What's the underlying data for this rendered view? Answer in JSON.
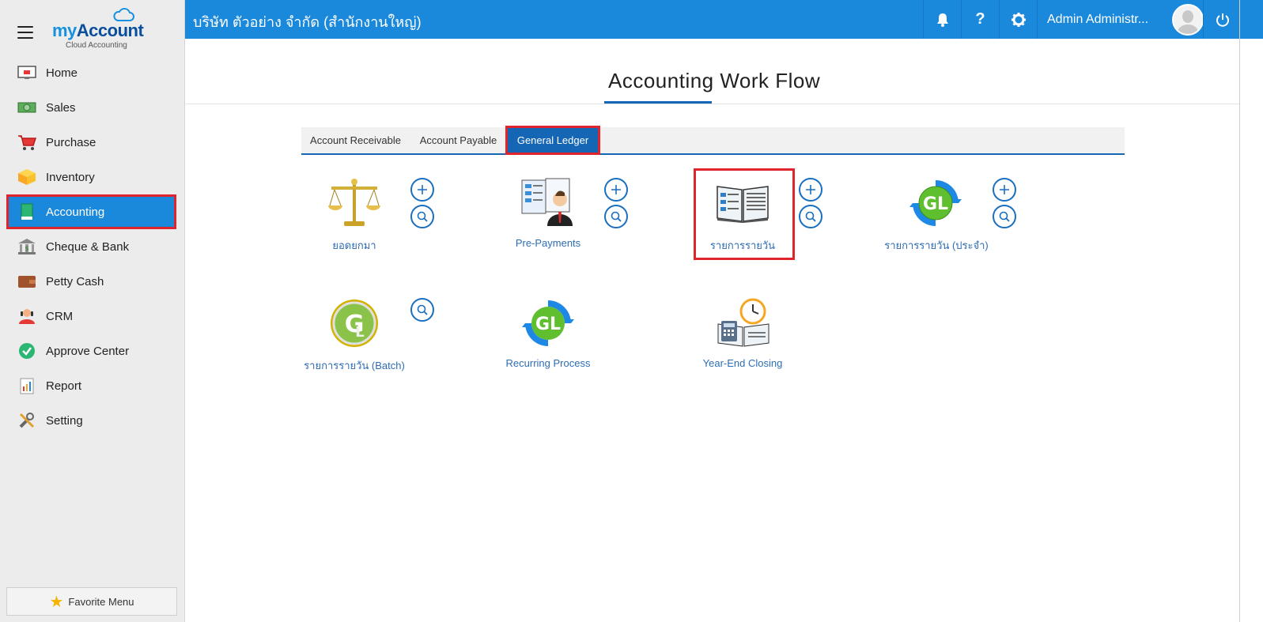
{
  "brand": {
    "name_my": "my",
    "name_account": "Account",
    "subtitle": "Cloud Accounting"
  },
  "sidebar": {
    "items": [
      {
        "label": "Home",
        "icon": "home-icon"
      },
      {
        "label": "Sales",
        "icon": "sales-icon"
      },
      {
        "label": "Purchase",
        "icon": "cart-icon"
      },
      {
        "label": "Inventory",
        "icon": "box-icon"
      },
      {
        "label": "Accounting",
        "icon": "book-icon",
        "active": true
      },
      {
        "label": "Cheque & Bank",
        "icon": "bank-icon"
      },
      {
        "label": "Petty Cash",
        "icon": "wallet-icon"
      },
      {
        "label": "CRM",
        "icon": "crm-icon"
      },
      {
        "label": "Approve Center",
        "icon": "check-icon"
      },
      {
        "label": "Report",
        "icon": "report-icon"
      },
      {
        "label": "Setting",
        "icon": "tools-icon"
      }
    ],
    "favorite_label": "Favorite Menu"
  },
  "topbar": {
    "company": "บริษัท ตัวอย่าง จำกัด (สำนักงานใหญ่)",
    "user_name": "Admin Administr..."
  },
  "page": {
    "title": "Accounting Work Flow"
  },
  "tabs": [
    {
      "label": "Account Receivable",
      "active": false
    },
    {
      "label": "Account Payable",
      "active": false
    },
    {
      "label": "General Ledger",
      "active": true
    }
  ],
  "workflow": {
    "row1": [
      {
        "label": "ยอดยกมา",
        "icon": "scale-icon",
        "add": true,
        "search": true
      },
      {
        "label": "Pre-Payments",
        "icon": "prepayment-icon",
        "add": true,
        "search": true
      },
      {
        "label": "รายการรายวัน",
        "icon": "journal-book-icon",
        "add": true,
        "search": true,
        "highlighted": true
      },
      {
        "label": "รายการรายวัน (ประจำ)",
        "icon": "gl-recurring-icon",
        "add": true,
        "search": true
      }
    ],
    "row2": [
      {
        "label": "รายการรายวัน (Batch)",
        "icon": "gl-batch-icon",
        "add": false,
        "search": true
      },
      {
        "label": "Recurring Process",
        "icon": "gl-process-icon",
        "add": false,
        "search": false
      },
      {
        "label": "Year-End Closing",
        "icon": "year-end-icon",
        "add": false,
        "search": false
      }
    ]
  },
  "colors": {
    "primary": "#1a88db",
    "dark_primary": "#1566b4",
    "highlight": "#e0242c",
    "link": "#2e6db4"
  }
}
